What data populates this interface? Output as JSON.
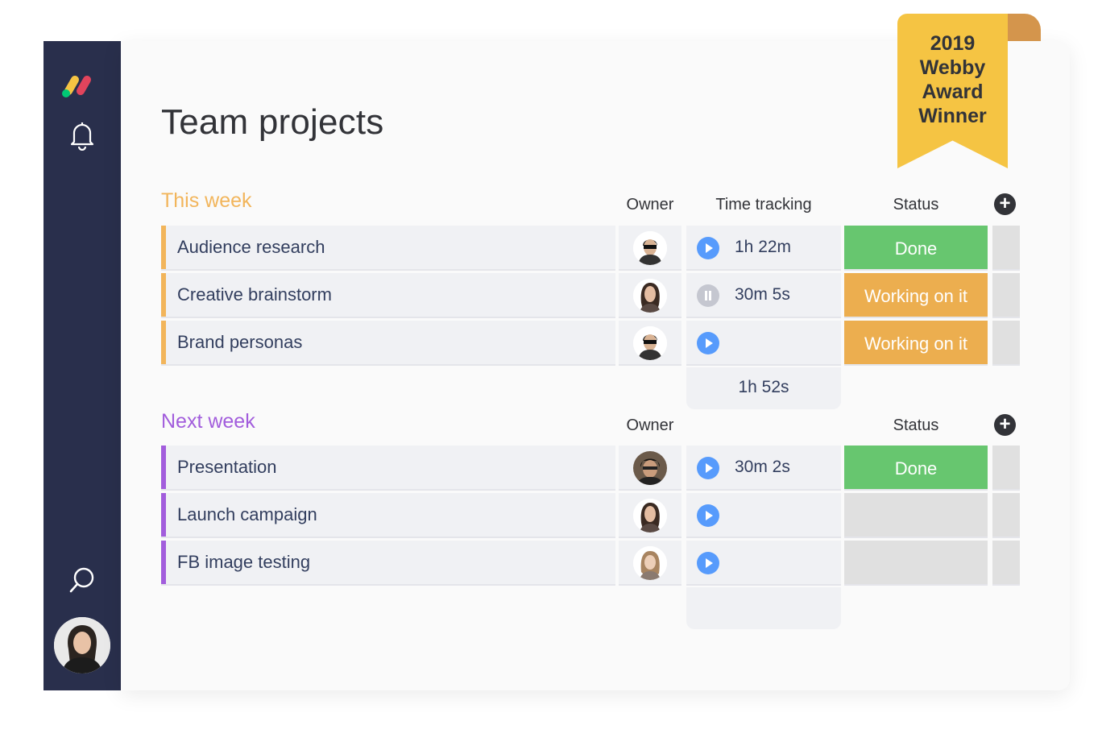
{
  "app": {
    "title": "Team projects",
    "accent_colors": {
      "sidebar": "#292f4c",
      "this_week": "#f2b55b",
      "next_week": "#a25ddc",
      "done": "#67c66f",
      "working": "#ecae4f",
      "play": "#579bfc"
    }
  },
  "sidebar": {
    "icons": [
      "monday-logo-icon",
      "bell-icon",
      "search-icon",
      "user-avatar"
    ]
  },
  "badge": {
    "lines": [
      "2019",
      "Webby",
      "Award",
      "Winner"
    ]
  },
  "groups": [
    {
      "title": "This week",
      "color": "#f2b55b",
      "columns": {
        "owner": "Owner",
        "time": "Time tracking",
        "status": "Status"
      },
      "rows": [
        {
          "name": "Audience research",
          "owner": "man-sunglasses-avatar",
          "timer": "play",
          "time": "1h 22m",
          "status": "Done",
          "status_color": "#67c66f"
        },
        {
          "name": "Creative brainstorm",
          "owner": "woman-dark-hair-avatar",
          "timer": "pause",
          "time": "30m 5s",
          "status": "Working on it",
          "status_color": "#ecae4f"
        },
        {
          "name": "Brand personas",
          "owner": "man-sunglasses-avatar",
          "timer": "play",
          "time": "",
          "status": "Working on it",
          "status_color": "#ecae4f"
        }
      ],
      "time_total": "1h 52s"
    },
    {
      "title": "Next week",
      "color": "#a25ddc",
      "columns": {
        "owner": "Owner",
        "time": "",
        "status": "Status"
      },
      "rows": [
        {
          "name": "Presentation",
          "owner": "man-glasses-avatar",
          "timer": "play",
          "time": "30m 2s",
          "status": "Done",
          "status_color": "#67c66f"
        },
        {
          "name": "Launch campaign",
          "owner": "woman-dark-hair-avatar",
          "timer": "play",
          "time": "",
          "status": "",
          "status_color": "#e0e0e0"
        },
        {
          "name": "FB image testing",
          "owner": "woman-blonde-avatar",
          "timer": "play",
          "time": "",
          "status": "",
          "status_color": "#e0e0e0"
        }
      ],
      "time_total": ""
    }
  ]
}
